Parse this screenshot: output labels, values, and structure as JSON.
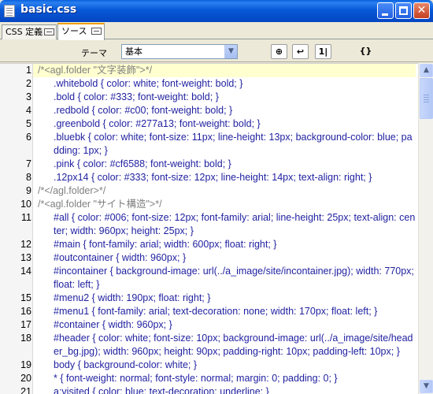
{
  "window": {
    "title": "basic.css",
    "icons": {
      "app": "document-icon",
      "minimize": "minimize-icon",
      "maximize": "maximize-icon",
      "close": "close-icon"
    },
    "close_glyph": "✕"
  },
  "tabs": [
    {
      "label": "CSS 定義",
      "icon": "panel-icon",
      "active": false
    },
    {
      "label": "ソース",
      "icon": "panel-icon",
      "active": true
    }
  ],
  "toolbar": {
    "theme_label": "テーマ",
    "theme_value": "基本",
    "buttons": [
      {
        "name": "color-button",
        "glyph": "⊕"
      },
      {
        "name": "wrap-button",
        "glyph": "↩"
      },
      {
        "name": "line-number-button",
        "glyph": "1|"
      },
      {
        "name": "braces-button",
        "glyph": "{}"
      }
    ]
  },
  "editor": {
    "lines": [
      {
        "n": "1",
        "text": "/*<agl.folder \"文字装飾\">*/",
        "kind": "comment",
        "indent": false,
        "highlight": true
      },
      {
        "n": "2",
        "text": ".whitebold { color: white; font-weight: bold; }",
        "kind": "rule",
        "indent": true
      },
      {
        "n": "3",
        "text": ".bold { color: #333; font-weight: bold; }",
        "kind": "rule",
        "indent": true
      },
      {
        "n": "4",
        "text": ".redbold { color: #c00; font-weight: bold; }",
        "kind": "rule",
        "indent": true
      },
      {
        "n": "5",
        "text": ".greenbold { color: #277a13; font-weight: bold; }",
        "kind": "rule",
        "indent": true
      },
      {
        "n": "6",
        "text": ".bluebk { color: white; font-size: 11px; line-height: 13px; background-color: blue; padding: 1px; }",
        "kind": "rule",
        "indent": true
      },
      {
        "n": "7",
        "text": ".pink { color: #cf6588; font-weight: bold; }",
        "kind": "rule",
        "indent": true
      },
      {
        "n": "8",
        "text": ".12px14 { color: #333; font-size: 12px; line-height: 14px; text-align: right; }",
        "kind": "rule",
        "indent": true
      },
      {
        "n": "9",
        "text": "/*</agl.folder>*/",
        "kind": "comment",
        "indent": false
      },
      {
        "n": "10",
        "text": "/*<agl.folder \"サイト構造\">*/",
        "kind": "comment",
        "indent": false
      },
      {
        "n": "11",
        "text": "#all { color: #006; font-size: 12px; font-family: arial; line-height: 25px; text-align: center; width: 960px; height: 25px; }",
        "kind": "rule",
        "indent": true
      },
      {
        "n": "12",
        "text": "#main { font-family: arial; width: 600px; float: right; }",
        "kind": "rule",
        "indent": true
      },
      {
        "n": "13",
        "text": "#outcontainer { width: 960px; }",
        "kind": "rule",
        "indent": true
      },
      {
        "n": "14",
        "text": "#incontainer { background-image: url(../a_image/site/incontainer.jpg); width: 770px; float: left; }",
        "kind": "rule",
        "indent": true
      },
      {
        "n": "15",
        "text": "#menu2 { width: 190px; float: right; }",
        "kind": "rule",
        "indent": true
      },
      {
        "n": "16",
        "text": "#menu1 { font-family: arial; text-decoration: none; width: 170px; float: left; }",
        "kind": "rule",
        "indent": true
      },
      {
        "n": "17",
        "text": "#container { width: 960px; }",
        "kind": "rule",
        "indent": true
      },
      {
        "n": "18",
        "text": "#header { color: white; font-size: 10px; background-image: url(../a_image/site/header_bg.jpg); width: 960px; height: 90px; padding-right: 10px; padding-left: 10px; }",
        "kind": "rule",
        "indent": true
      },
      {
        "n": "19",
        "text": "body { background-color: white; }",
        "kind": "rule",
        "indent": true
      },
      {
        "n": "20",
        "text": "* { font-weight: normal; font-style: normal; margin: 0; padding: 0; }",
        "kind": "rule",
        "indent": true
      },
      {
        "n": "21",
        "text": "a:visited { color: blue; text-decoration: underline; }",
        "kind": "rule",
        "indent": true
      }
    ]
  },
  "scrollbar": {
    "up_glyph": "▲",
    "down_glyph": "▼",
    "position": 0.02
  }
}
